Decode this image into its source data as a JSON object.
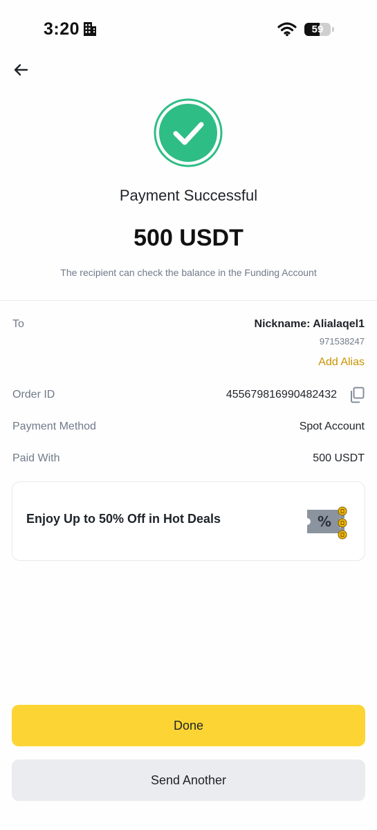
{
  "status_bar": {
    "time": "3:20",
    "battery": "59",
    "battery_level": 0.59
  },
  "icons": {
    "back": "arrow-left-icon",
    "building": "building-icon",
    "wifi": "wifi-icon",
    "battery": "battery-icon",
    "success": "check-circle-icon",
    "copy": "copy-icon",
    "promo": "discount-ticket-icon"
  },
  "result": {
    "title": "Payment Successful",
    "amount": "500 USDT",
    "note": "The recipient can check the balance in the Funding Account"
  },
  "details": {
    "to_label": "To",
    "nickname": "Nickname: Alialaqel1",
    "uid": "971538247",
    "add_alias": "Add Alias",
    "order_label": "Order ID",
    "order_id": "455679816990482432",
    "method_label": "Payment Method",
    "method_value": "Spot Account",
    "paid_label": "Paid With",
    "paid_value": "500 USDT"
  },
  "promo": {
    "text": "Enjoy Up to 50% Off in Hot Deals"
  },
  "actions": {
    "done": "Done",
    "send_another": "Send Another"
  },
  "colors": {
    "accent_yellow": "#fcd535",
    "success_green": "#2ebd85",
    "link_gold": "#c99400",
    "secondary_gray": "#eaecef"
  }
}
